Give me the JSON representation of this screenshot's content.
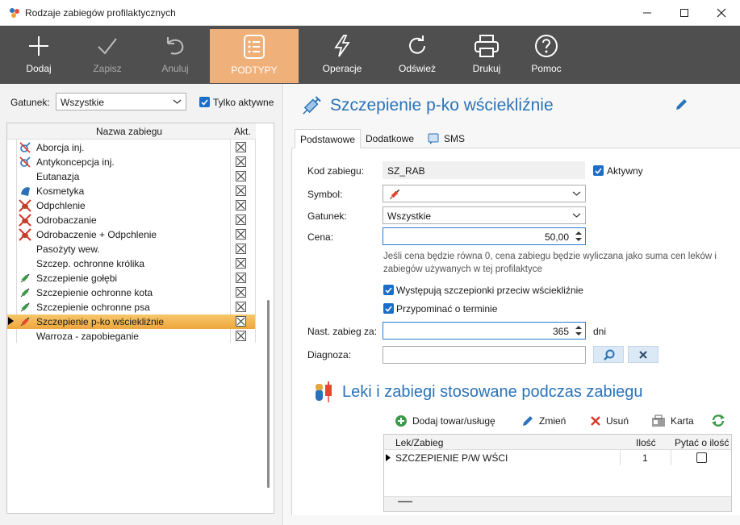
{
  "window": {
    "title": "Rodzaje zabiegów profilaktycznych"
  },
  "toolbar": {
    "buttons": [
      {
        "label": "Dodaj",
        "icon": "plus-icon",
        "state": "enabled"
      },
      {
        "label": "Zapisz",
        "icon": "checkmark-icon",
        "state": "disabled"
      },
      {
        "label": "Anuluj",
        "icon": "undo-icon",
        "state": "disabled"
      },
      {
        "label": "PODTYPY",
        "icon": "list-icon",
        "state": "active"
      },
      {
        "label": "Operacje",
        "icon": "lightning-icon",
        "state": "enabled"
      },
      {
        "label": "Odśwież",
        "icon": "refresh-icon",
        "state": "enabled"
      },
      {
        "label": "Drukuj",
        "icon": "printer-icon",
        "state": "enabled"
      },
      {
        "label": "Pomoc",
        "icon": "help-icon",
        "state": "enabled"
      }
    ],
    "active_color": "#f0b07a",
    "background": "#4f4f4f"
  },
  "left": {
    "gatunek_label": "Gatunek:",
    "gatunek_value": "Wszystkie",
    "only_active_label": "Tylko aktywne",
    "only_active_checked": true,
    "grid": {
      "col_name": "Nazwa zabiegu",
      "col_active": "Akt.",
      "rows": [
        {
          "name": "Aborcja inj.",
          "icon": "gender-symbol-icon",
          "active": true
        },
        {
          "name": "Antykoncepcja inj.",
          "icon": "gender-symbol-icon",
          "active": true
        },
        {
          "name": "Eutanazja",
          "icon": "",
          "active": true
        },
        {
          "name": "Kosmetyka",
          "icon": "comb-icon",
          "active": true
        },
        {
          "name": "Odpchlenie",
          "icon": "flea-icon",
          "active": true
        },
        {
          "name": "Odrobaczanie",
          "icon": "flea-icon",
          "active": true
        },
        {
          "name": "Odrobaczenie + Odpchlenie",
          "icon": "flea-icon",
          "active": true
        },
        {
          "name": "Pasożyty wew.",
          "icon": "",
          "active": true
        },
        {
          "name": "Szczep. ochronne królika",
          "icon": "",
          "active": true
        },
        {
          "name": "Szczepienie gołębi",
          "icon": "syringe-green-icon",
          "active": true
        },
        {
          "name": "Szczepienie ochronne kota",
          "icon": "syringe-green-icon",
          "active": true
        },
        {
          "name": "Szczepienie ochronne psa",
          "icon": "syringe-green-icon",
          "active": true
        },
        {
          "name": "Szczepienie p-ko wściekliźnie",
          "icon": "syringe-red-icon",
          "active": true,
          "selected": true
        },
        {
          "name": "Warroza - zapobieganie",
          "icon": "",
          "active": true
        }
      ]
    }
  },
  "right": {
    "title": "Szczepienie p-ko wściekliźnie",
    "tabs": [
      "Podstawowe",
      "Dodatkowe",
      "SMS"
    ],
    "active_tab": "Podstawowe",
    "form": {
      "kod_label": "Kod zabiegu:",
      "kod_value": "SZ_RAB",
      "aktywny_label": "Aktywny",
      "aktywny_checked": true,
      "symbol_label": "Symbol:",
      "gatunek_label": "Gatunek:",
      "gatunek_value": "Wszystkie",
      "cena_label": "Cena:",
      "cena_value": "50,00",
      "cena_note": "Jeśli cena będzie równa 0, cena zabiegu będzie wyliczana jako suma cen leków i zabiegów używanych w tej profilaktyce",
      "rabies_vaccine_label": "Występują szczepionki przeciw wściekliźnie",
      "rabies_vaccine_checked": true,
      "remind_label": "Przypominać o terminie",
      "remind_checked": true,
      "nast_label": "Nast. zabieg za:",
      "nast_value": "365",
      "nast_unit": "dni",
      "diagnoza_label": "Diagnoza:",
      "diagnoza_value": ""
    },
    "section": {
      "title": "Leki i zabiegi stosowane podczas zabiegu",
      "add_label": "Dodaj towar/usługę",
      "edit_label": "Zmień",
      "delete_label": "Usuń",
      "card_label": "Karta",
      "grid": {
        "col_name": "Lek/Zabieg",
        "col_qty": "Ilość",
        "col_ask": "Pytać o ilość",
        "rows": [
          {
            "name": "SZCZEPIENIE P/W WŚCI",
            "qty": "1",
            "ask": false
          }
        ]
      }
    }
  }
}
